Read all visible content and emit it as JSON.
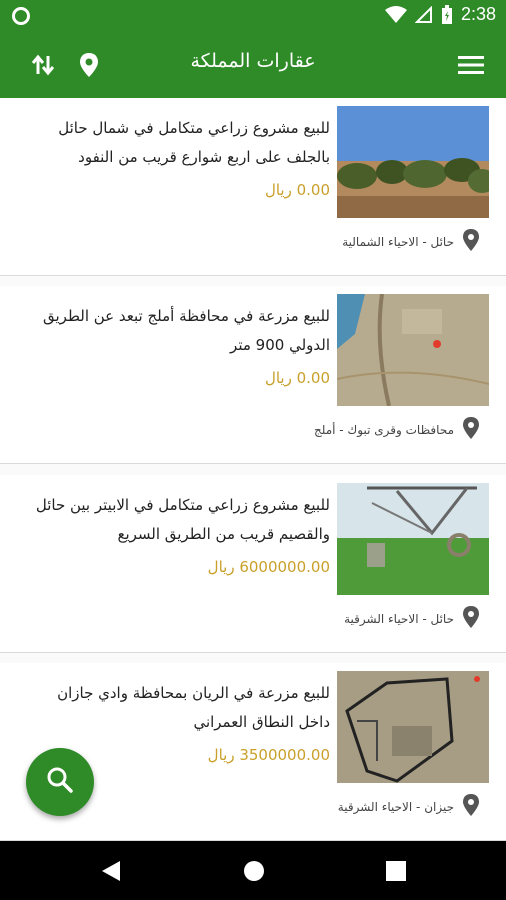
{
  "status_bar": {
    "time": "2:38",
    "icons": [
      "circle-icon",
      "wifi-icon",
      "signal-icon",
      "battery-icon"
    ]
  },
  "app_bar": {
    "title": "عقارات المملكة",
    "icons": [
      "menu-icon",
      "location-pin-icon",
      "sort-icon"
    ]
  },
  "listings": [
    {
      "title": "للبيع مشروع زراعي متكامل في شمال حائل بالجلف على اربع شوارع قريب من النفود",
      "price": "0.00 ريال",
      "location": "حائل - الاحياء الشمالية",
      "image": "palm-farm-photo"
    },
    {
      "title": "للبيع مزرعة في محافظة أملج تبعد عن الطريق الدولي 900 متر",
      "price": "0.00 ريال",
      "location": "محافظات وقرى تبوك - أملج",
      "image": "satellite-map"
    },
    {
      "title": "للبيع مشروع زراعي متكامل في الابيتر بين حائل والقصيم قريب من الطريق السريع",
      "price": "6000000.00 ريال",
      "location": "حائل - الاحياء الشرقية",
      "image": "pivot-irrigation-photo"
    },
    {
      "title": "للبيع مزرعة في الريان بمحافظة وادي جازان داخل النطاق العمراني",
      "price": "3500000.00 ريال",
      "location": "جيزان - الاحياء الشرقية",
      "image": "satellite-plot-map"
    }
  ],
  "fab": {
    "icon": "search-icon"
  },
  "nav_bar": {
    "icons": [
      "back-icon",
      "home-icon",
      "recents-icon"
    ]
  },
  "colors": {
    "primary": "#2e8b27",
    "price": "#c9a02a"
  }
}
